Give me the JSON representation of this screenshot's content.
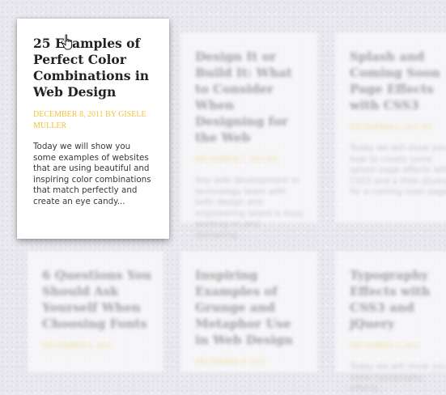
{
  "posts": [
    {
      "title": "25 Examples of Perfect Color Combinations in Web Design",
      "meta": "December 8, 2011 by Gisele Muller",
      "excerpt": "Today we will show you some examples of websites that are using beautiful and inspiring color combinations that match perfectly and create an eye candy..."
    },
    {
      "title": "Design It or Build It: What to Consider When Designing for the Web",
      "meta": "December 7, 2011 by",
      "excerpt": "Any web development or technology team with both design and engineering talent is busy working on and delivering..."
    },
    {
      "title": "Splash and Coming Soon Page Effects with CSS3",
      "meta": "December 6, 2011 by",
      "excerpt": "Today we will show you how to create some splash page effects with CSS3 and a little jQuery for a coming soon page..."
    },
    {
      "title": "6 Questions You Should Ask Yourself When Choosing Fonts",
      "meta": "December 5, 2011",
      "excerpt": ""
    },
    {
      "title": "Inspiring Examples of Grunge and Metaphor Use in Web Design",
      "meta": "December 4, 2011",
      "excerpt": ""
    },
    {
      "title": "Typography Effects with CSS3 and jQuery",
      "meta": "December 3, 2011",
      "excerpt": "Today we will show you some typography effects..."
    }
  ]
}
